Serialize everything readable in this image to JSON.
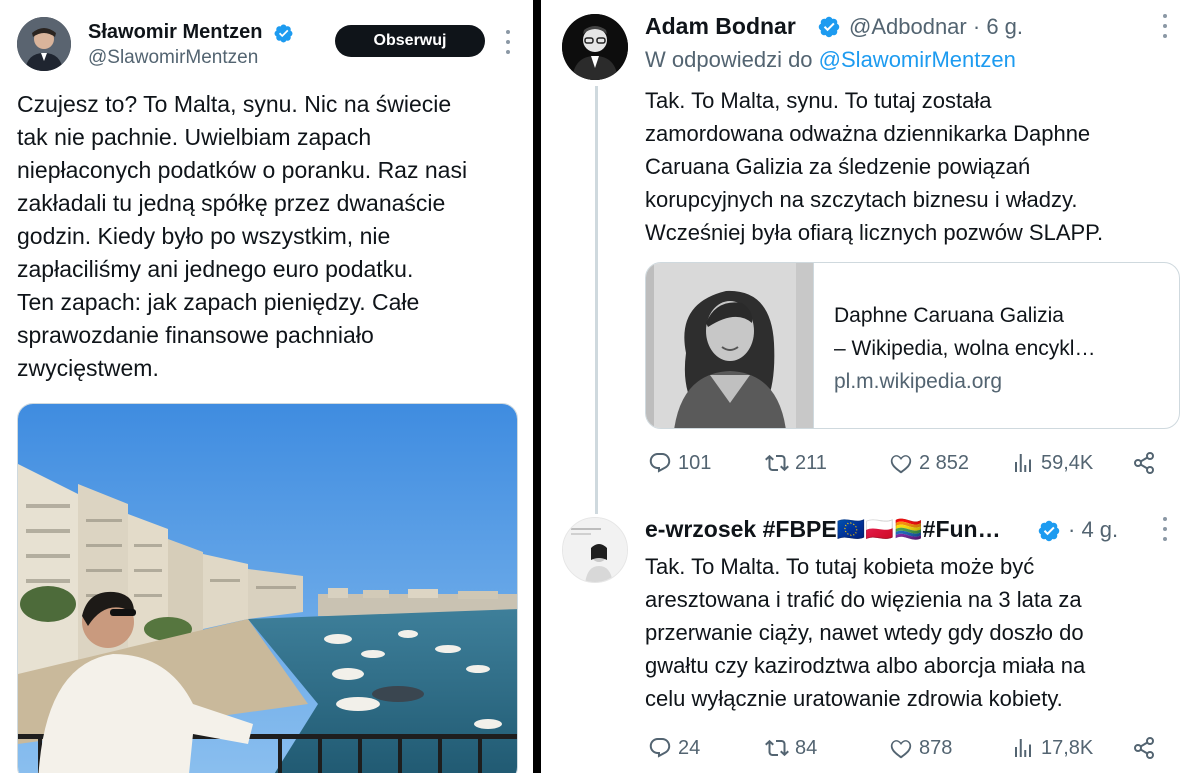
{
  "left_tweet": {
    "author_name": "Sławomir Mentzen",
    "author_handle": "@SlawomirMentzen",
    "follow_label": "Obserwuj",
    "text_lines": [
      "Czujesz to? To Malta, synu. Nic na świecie",
      "tak nie pachnie. Uwielbiam zapach",
      "niepłaconych podatków o poranku. Raz nasi",
      "zakładali tu jedną spółkę przez dwanaście",
      "godzin. Kiedy było po wszystkim, nie",
      "zapłaciliśmy ani jednego euro podatku.",
      "Ten zapach: jak zapach pieniędzy. Całe",
      "sprawozdanie finansowe pachniało",
      "zwycięstwem."
    ]
  },
  "reply1": {
    "author_name": "Adam Bodnar",
    "author_handle": "@Adbodnar",
    "separator": "·",
    "time": "6 g.",
    "reply_prefix": "W odpowiedzi do",
    "reply_to": "@SlawomirMentzen",
    "text_lines": [
      "Tak. To Malta, synu. To tutaj została",
      "zamordowana odważna dziennikarka Daphne",
      "Caruana Galizia za śledzenie powiązań",
      "korupcyjnych na szczytach biznesu i władzy.",
      "Wcześniej była ofiarą licznych pozwów SLAPP."
    ],
    "card": {
      "title_line1": "Daphne Caruana Galizia",
      "title_line2": "– Wikipedia, wolna encykl…",
      "domain": "pl.m.wikipedia.org"
    },
    "stats": {
      "replies": "101",
      "reposts": "211",
      "likes": "2 852",
      "views": "59,4K"
    }
  },
  "reply2": {
    "author_name": "e-wrzosek #FBPE🇪🇺🇵🇱🏳️‍🌈#Fun…",
    "separator": "·",
    "time": "4 g.",
    "text_lines": [
      "Tak. To Malta. To tutaj kobieta może być",
      "aresztowana i trafić do więzienia na 3 lata za",
      "przerwanie ciąży, nawet wtedy gdy doszło do",
      "gwałtu czy kazirodztwa albo aborcja miała na",
      "celu wyłącznie uratowanie zdrowia kobiety."
    ],
    "stats": {
      "replies": "24",
      "reposts": "84",
      "likes": "878",
      "views": "17,8K"
    }
  },
  "colors": {
    "verified": "#1d9bf0",
    "link": "#1d9bf0",
    "muted": "#536471",
    "text": "#0f1419"
  },
  "icons": [
    "verified-badge-icon",
    "more-icon",
    "reply-icon",
    "repost-icon",
    "like-icon",
    "views-icon",
    "share-icon"
  ]
}
